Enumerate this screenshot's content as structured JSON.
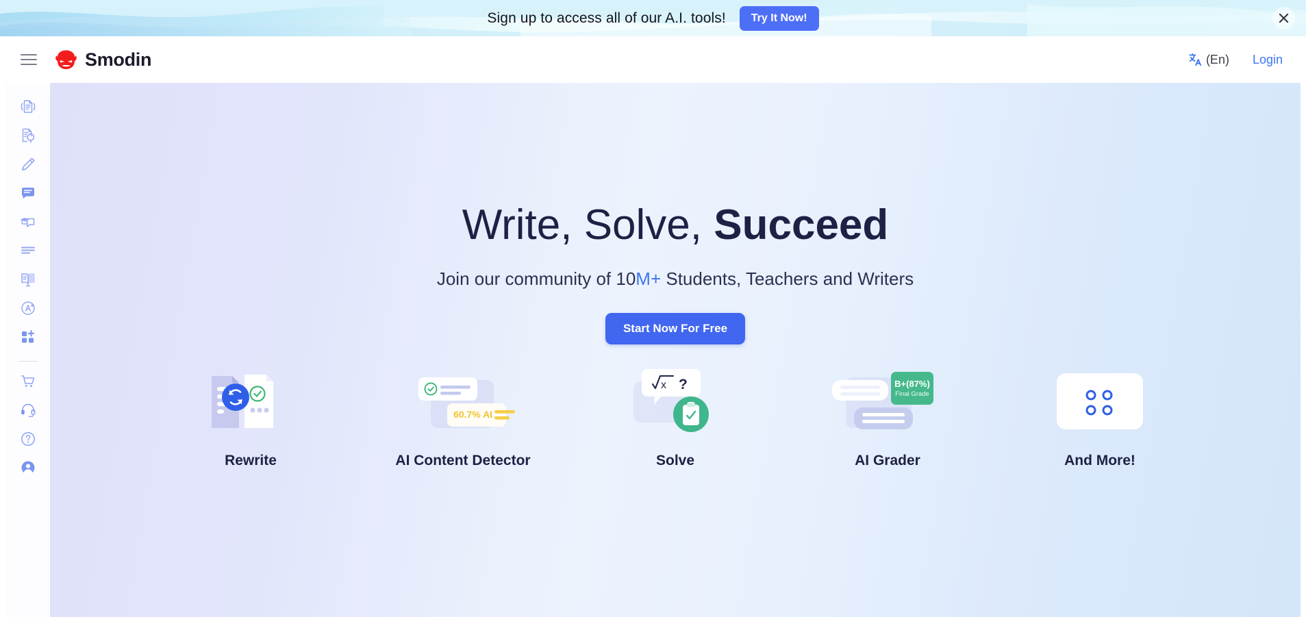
{
  "promo": {
    "text": "Sign up to access all of our A.I. tools!",
    "cta_label": "Try It Now!",
    "close_icon": "close-icon",
    "cta_color": "#4d6ff5"
  },
  "topbar": {
    "menu_icon": "hamburger-menu-icon",
    "logo_icon": "smodin-robot-logo-icon",
    "brand": "Smodin",
    "language": "(En)",
    "language_icon": "translate-icon",
    "login_label": "Login",
    "link_color": "#3d76f0"
  },
  "sidebar": {
    "items": [
      {
        "name": "rewriter",
        "icon": "document-rewrite-icon"
      },
      {
        "name": "ai-content-detector",
        "icon": "document-search-icon"
      },
      {
        "name": "writer",
        "icon": "pencil-icon"
      },
      {
        "name": "chat",
        "icon": "chat-bubble-icon"
      },
      {
        "name": "homework-help",
        "icon": "graduation-chat-icon"
      },
      {
        "name": "summarizer",
        "icon": "text-lines-icon"
      },
      {
        "name": "reference-generator",
        "icon": "open-book-icon"
      },
      {
        "name": "ai-grader",
        "icon": "grade-a-plus-icon"
      },
      {
        "name": "more-tools",
        "icon": "grid-plus-icon"
      }
    ],
    "bottom_items": [
      {
        "name": "pricing",
        "icon": "shopping-cart-icon"
      },
      {
        "name": "support",
        "icon": "headset-icon"
      },
      {
        "name": "help",
        "icon": "question-circle-icon"
      },
      {
        "name": "account",
        "icon": "user-circle-icon"
      }
    ]
  },
  "hero": {
    "title_part1": "Write, Solve, ",
    "title_part2": "Succeed",
    "subtitle_pre": "Join our community of 10",
    "subtitle_highlight": "M+",
    "subtitle_post": " Students, Teachers and Writers",
    "cta_label": "Start Now For Free",
    "cta_color": "#4166ef",
    "highlight_color": "#3d76f0"
  },
  "features": [
    {
      "label": "Rewrite",
      "icon": "rewrite-documents-illustration",
      "badge": "",
      "accent": "#3d63e8"
    },
    {
      "label": "AI Content Detector",
      "icon": "ai-detection-cards-illustration",
      "badge": "60.7% AI",
      "accent": "#f3c623"
    },
    {
      "label": "Solve",
      "icon": "math-solve-illustration",
      "badge": "√x  ?",
      "accent": "#3fb68b"
    },
    {
      "label": "AI Grader",
      "icon": "grading-cards-illustration",
      "badge": "B+(87%)",
      "badge_sub": "Final Grade",
      "accent": "#45b98c"
    },
    {
      "label": "And More!",
      "icon": "more-tools-card-illustration",
      "badge": "",
      "accent": "#3d63e8"
    }
  ]
}
